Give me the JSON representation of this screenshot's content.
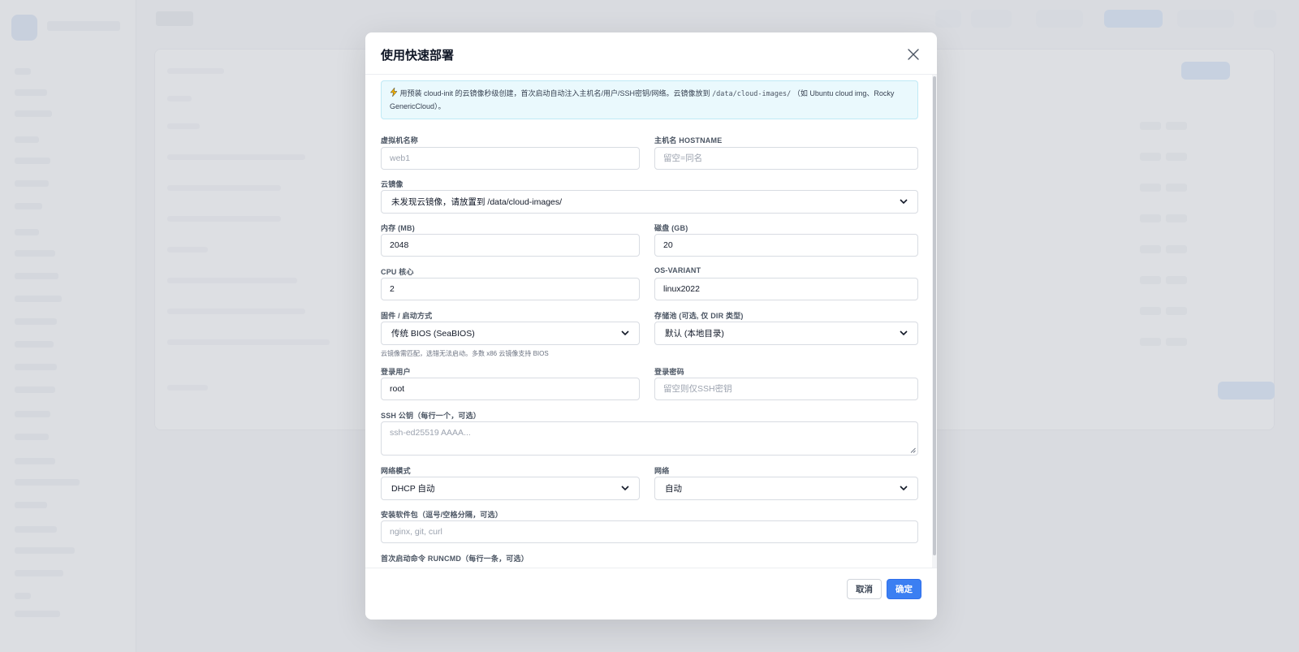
{
  "modal": {
    "title": "使用快速部署",
    "notice_prefix": "用预装 cloud-init 的云镜像秒级创建，首次启动自动注入主机名/用户/SSH密钥/网络。云镜像放到",
    "notice_path": "/data/cloud-images/",
    "notice_suffix": "（如 Ubuntu cloud img、Rocky GenericCloud）。",
    "vm_name": {
      "label": "虚拟机名称",
      "value": "",
      "placeholder": "web1"
    },
    "hostname": {
      "label": "主机名 HOSTNAME",
      "value": "",
      "placeholder": "留空=同名"
    },
    "cloud_image": {
      "label": "云镜像",
      "selected": "未发现云镜像，请放置到 /data/cloud-images/"
    },
    "memory": {
      "label": "内存 (MB)",
      "value": "2048"
    },
    "disk": {
      "label": "磁盘 (GB)",
      "value": "20"
    },
    "cpu": {
      "label": "CPU 核心",
      "value": "2"
    },
    "os_variant": {
      "label": "OS-VARIANT",
      "value": "linux2022"
    },
    "firmware": {
      "label": "固件 / 启动方式",
      "selected": "传统 BIOS (SeaBIOS)",
      "hint": "云镜像需匹配，选错无法启动。多数 x86 云镜像支持 BIOS"
    },
    "storage_pool": {
      "label": "存储池 (可选, 仅 DIR 类型)",
      "selected": "默认 (本地目录)"
    },
    "login_user": {
      "label": "登录用户",
      "value": "root"
    },
    "login_password": {
      "label": "登录密码",
      "value": "",
      "placeholder": "留空则仅SSH密钥"
    },
    "ssh_key": {
      "label": "SSH 公钥（每行一个，可选）",
      "value": "",
      "placeholder": "ssh-ed25519 AAAA..."
    },
    "network_mode": {
      "label": "网络模式",
      "selected": "DHCP 自动"
    },
    "network": {
      "label": "网络",
      "selected": "自动"
    },
    "packages": {
      "label": "安装软件包（逗号/空格分隔，可选）",
      "value": "",
      "placeholder": "nginx, git, curl"
    },
    "runcmd": {
      "label": "首次启动命令 RUNCMD（每行一条，可选）"
    },
    "cancel_label": "取消",
    "ok_label": "确定"
  },
  "icons": {
    "notice": "lightning-icon",
    "close": "close-icon",
    "select": "chevron-down-icon"
  },
  "colors": {
    "primary": "#3b7ff2",
    "notice_bg": "#eaf9fd",
    "notice_border": "#bfe9f6"
  }
}
